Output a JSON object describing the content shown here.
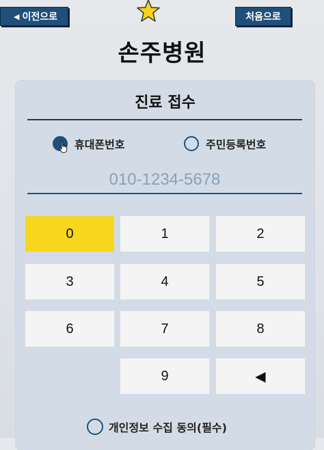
{
  "header": {
    "back_label": "이전으로",
    "home_label": "처음으로"
  },
  "hospital_name": "손주병원",
  "panel": {
    "title": "진료 접수",
    "options": [
      {
        "label": "휴대폰번호",
        "selected": true
      },
      {
        "label": "주민등록번호",
        "selected": false
      }
    ],
    "phone_placeholder": "010-1234-5678",
    "keypad": [
      {
        "label": "0",
        "active": true
      },
      {
        "label": "1"
      },
      {
        "label": "2"
      },
      {
        "label": "3"
      },
      {
        "label": "4"
      },
      {
        "label": "5"
      },
      {
        "label": "6"
      },
      {
        "label": "7"
      },
      {
        "label": "8"
      },
      {
        "label": "9"
      },
      {
        "label": "◀",
        "icon": "backspace-icon"
      }
    ],
    "consent_label": "개인정보 수집 동의(필수)"
  },
  "colors": {
    "accent": "#1f4f7a",
    "key_active": "#f7d61e",
    "key_default": "#f4f4f4",
    "star": "#f7d21a"
  }
}
